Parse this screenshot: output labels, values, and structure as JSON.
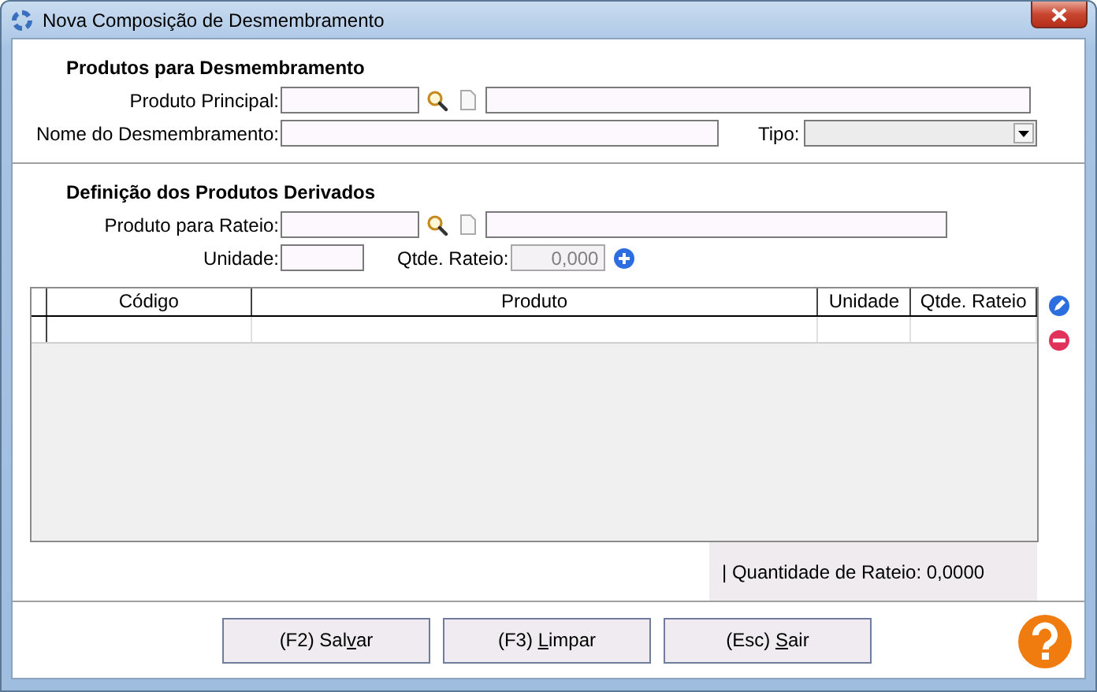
{
  "window": {
    "title": "Nova Composição de Desmembramento"
  },
  "main_products": {
    "heading": "Produtos para Desmembramento",
    "produto_principal": {
      "label": "Produto Principal:"
    },
    "nome": {
      "label": "Nome do Desmembramento:"
    },
    "tipo": {
      "label": "Tipo:",
      "disabled": true
    }
  },
  "derived_products": {
    "heading": "Definição dos Produtos Derivados",
    "produto_rateio": {
      "label": "Produto para Rateio:"
    },
    "unidade": {
      "label": "Unidade:"
    },
    "qtde_rateio": {
      "label": "Qtde. Rateio:",
      "value": "0,000",
      "disabled": true
    }
  },
  "table": {
    "columns": [
      "Código",
      "Produto",
      "Unidade",
      "Qtde. Rateio"
    ]
  },
  "summary": "| Quantidade de Rateio: 0,0000",
  "buttons": [
    {
      "before": "(F2) Sal",
      "key": "v",
      "after": "ar"
    },
    {
      "before": "(F3) ",
      "key": "L",
      "after": "impar"
    },
    {
      "before": "(Esc) ",
      "key": "S",
      "after": "air"
    }
  ]
}
